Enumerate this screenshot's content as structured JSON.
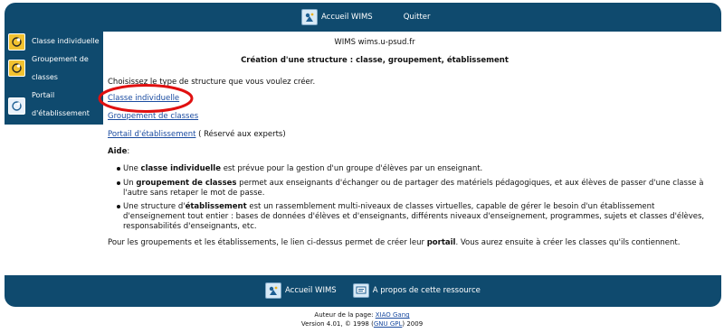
{
  "topbar": {
    "home_label": "Accueil WIMS",
    "quit_label": "Quitter"
  },
  "sidebar": {
    "items": [
      {
        "line1": "Classe individuelle",
        "line2": ""
      },
      {
        "line1": "Groupement de",
        "line2": "classes"
      },
      {
        "line1": "Portail",
        "line2": "d'établissement"
      }
    ]
  },
  "main": {
    "host": "WIMS wims.u-psud.fr",
    "title": "Création d'une structure : classe, groupement, établissement",
    "intro": "Choisissez le type de structure que vous voulez créer.",
    "links": {
      "classe": "Classe individuelle",
      "groupement": "Groupement de classes",
      "portail": "Portail d'établissement",
      "portail_note": "( Réservé aux experts)"
    },
    "aide_label": "Aide",
    "aide_colon": ":",
    "bullets": [
      {
        "pre": "Une ",
        "bold": "classe individuelle",
        "post": " est prévue pour la gestion d'un groupe d'élèves par un enseignant."
      },
      {
        "pre": "Un ",
        "bold": "groupement de classes",
        "post": " permet aux enseignants d'échanger ou de partager des matériels pédagogiques, et aux élèves de passer d'une classe à l'autre sans retaper le mot de passe."
      },
      {
        "pre": "Une structure d'",
        "bold": "établissement",
        "post": " est un rassemblement multi-niveaux de classes virtuelles, capable de gérer le besoin d'un établissement d'enseignement tout entier : bases de données d'élèves et d'enseignants, différents niveaux d'enseignement, programmes, sujets et classes d'élèves, responsabilités d'enseignants, etc."
      }
    ],
    "closing_pre": "Pour les groupements et les établissements, le lien ci-dessus permet de créer leur ",
    "closing_bold": "portail",
    "closing_post": ". Vous aurez ensuite à créer les classes qu'ils contiennent."
  },
  "footer": {
    "home_label": "Accueil WIMS",
    "about_label": "A propos de cette ressource",
    "author_prefix": "Auteur de la page: ",
    "author_name": "XIAO Gang",
    "version_prefix": "Version 4.01, © 1998 (",
    "license": "GNU GPL",
    "version_suffix": ") 2009"
  },
  "colors": {
    "bar": "#0f4a6e",
    "link": "#1a4ba0",
    "annotation": "#e01010"
  }
}
